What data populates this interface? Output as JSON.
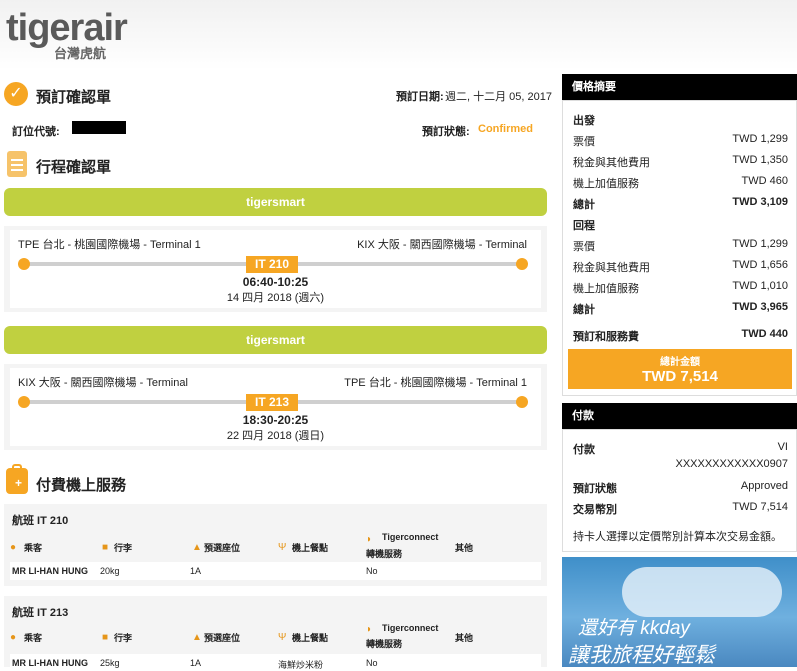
{
  "header": {
    "logo_text": "tigerair",
    "logo_sub": "台灣虎航"
  },
  "booking": {
    "title": "預訂確認單",
    "date_label": "預訂日期:",
    "date_value": "週二, 十二月 05, 2017",
    "code_label": "訂位代號:",
    "status_label": "預訂狀態:",
    "status_value": "Confirmed"
  },
  "itinerary": {
    "title": "行程確認單",
    "flights": [
      {
        "brand": "tigersmart",
        "from": "TPE 台北 - 桃園國際機場 - Terminal 1",
        "to": "KIX 大阪 - 關西國際機場 - Terminal",
        "flight_no": "IT 210",
        "time": "06:40-10:25",
        "date": "14 四月 2018 (週六)"
      },
      {
        "brand": "tigersmart",
        "from": "KIX 大阪 - 關西國際機場 - Terminal",
        "to": "TPE 台北 - 桃園國際機場 - Terminal 1",
        "flight_no": "IT 213",
        "time": "18:30-20:25",
        "date": "22 四月 2018 (週日)"
      }
    ]
  },
  "services": {
    "title": "付費機上服務",
    "headers": {
      "passenger": "乘客",
      "baggage": "行李",
      "seat": "預選座位",
      "meal": "機上餐點",
      "tigerconnect": "Tigerconnect",
      "transfer": "轉機服務",
      "other": "其他"
    },
    "flights": [
      {
        "title": "航班 IT 210",
        "row": {
          "passenger": "MR LI-HAN HUNG",
          "baggage": "20kg",
          "seat": "1A",
          "meal": "",
          "tigerconnect": "No"
        }
      },
      {
        "title": "航班 IT 213",
        "row": {
          "passenger": "MR LI-HAN HUNG",
          "baggage": "25kg",
          "seat": "1A",
          "meal": "海鮮炒米粉",
          "tigerconnect": "No"
        }
      }
    ]
  },
  "price": {
    "title": "價格摘要",
    "outbound_label": "出發",
    "outbound": [
      {
        "label": "票價",
        "value": "TWD 1,299"
      },
      {
        "label": "稅金與其他費用",
        "value": "TWD 1,350"
      },
      {
        "label": "機上加值服務",
        "value": "TWD 460"
      }
    ],
    "outbound_total": {
      "label": "總計",
      "value": "TWD 3,109"
    },
    "return_label": "回程",
    "return": [
      {
        "label": "票價",
        "value": "TWD 1,299"
      },
      {
        "label": "稅金與其他費用",
        "value": "TWD 1,656"
      },
      {
        "label": "機上加值服務",
        "value": "TWD 1,010"
      }
    ],
    "return_total": {
      "label": "總計",
      "value": "TWD 3,965"
    },
    "booking_fee": {
      "label": "預訂和服務費",
      "value": "TWD 440"
    },
    "grand_total_label": "總計金額",
    "grand_total_value": "TWD 7,514"
  },
  "payment": {
    "title": "付款",
    "method_label": "付款",
    "method_value": "VI",
    "card_number": "XXXXXXXXXXXX0907",
    "status_label": "預訂狀態",
    "status_value": "Approved",
    "currency_label": "交易幣別",
    "currency_value": "TWD 7,514",
    "note": "持卡人選擇以定價幣別計算本次交易金額。"
  },
  "ad": {
    "line1": "還好有 kkday",
    "line2": "讓我旅程好輕鬆"
  },
  "colors": {
    "accent": "#f6a623",
    "green": "#c0d040",
    "dark": "#000000"
  }
}
